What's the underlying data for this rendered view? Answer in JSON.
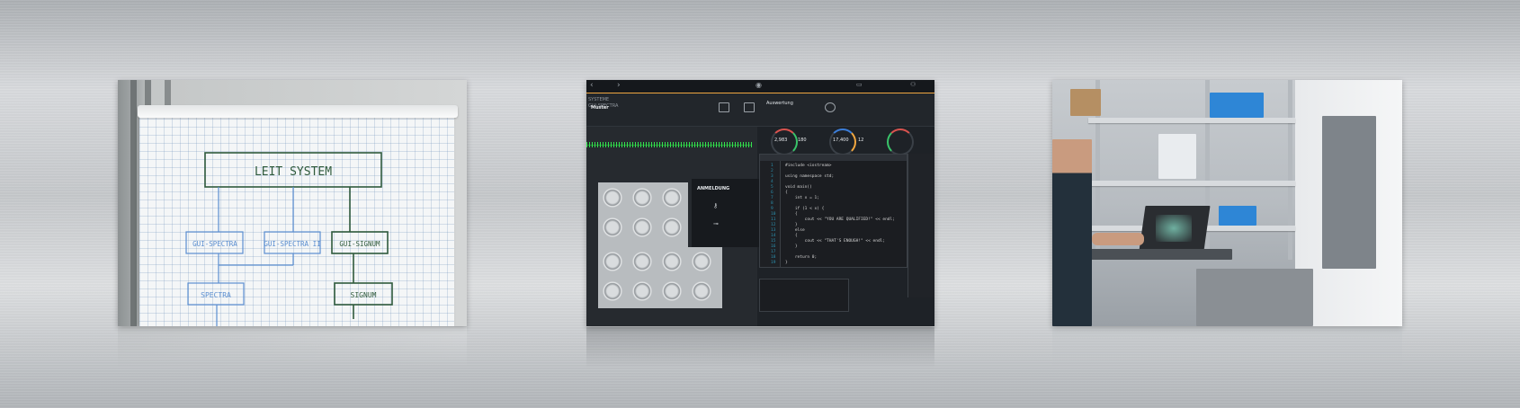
{
  "panels": [
    {
      "name": "flipchart-panel",
      "diagram": {
        "top": "LEIT SYSTEM",
        "mid_left": "GUI-SPECTRA",
        "mid_center": "GUI-SPECTRA II",
        "mid_right": "GUI-SIGNUM",
        "bottom_left": "SPECTRA",
        "bottom_right": "SIGNUM"
      }
    },
    {
      "name": "software-panel",
      "system_line1": "SYSTEME",
      "system_line2": "GUI-SPECTRA",
      "active_tab": "Auswertung",
      "pattern_label": "Muster",
      "login_title": "ANMELDUNG",
      "gauges": [
        "2,983",
        "180",
        "17,400",
        "12"
      ],
      "code_lines": [
        "#include <iostream>",
        "",
        "using namespace std;",
        "",
        "void main()",
        "{",
        "    int x = 1;",
        "",
        "    if (1 < x) {",
        "    {",
        "        cout << \"YOU ARE QUALIFIED!\" << endl;",
        "    }",
        "    else",
        "    {",
        "        cout << \"THAT'S ENOUGH!\" << endl;",
        "    }",
        "",
        "    return 0;",
        "}"
      ]
    },
    {
      "name": "lab-photo-panel"
    }
  ],
  "colors": {
    "accent_orange": "#f0a640",
    "signal_green": "#34e34f",
    "marker_blue": "#5b8ed0",
    "marker_green": "#3f6a4a",
    "crate_blue": "#2e86d6"
  }
}
